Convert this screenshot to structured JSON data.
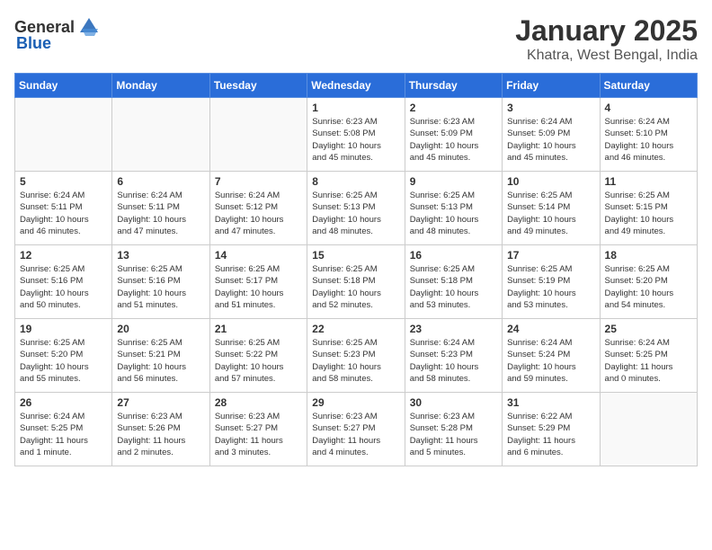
{
  "header": {
    "logo_general": "General",
    "logo_blue": "Blue",
    "title": "January 2025",
    "subtitle": "Khatra, West Bengal, India"
  },
  "days_of_week": [
    "Sunday",
    "Monday",
    "Tuesday",
    "Wednesday",
    "Thursday",
    "Friday",
    "Saturday"
  ],
  "weeks": [
    [
      {
        "day": "",
        "info": ""
      },
      {
        "day": "",
        "info": ""
      },
      {
        "day": "",
        "info": ""
      },
      {
        "day": "1",
        "info": "Sunrise: 6:23 AM\nSunset: 5:08 PM\nDaylight: 10 hours\nand 45 minutes."
      },
      {
        "day": "2",
        "info": "Sunrise: 6:23 AM\nSunset: 5:09 PM\nDaylight: 10 hours\nand 45 minutes."
      },
      {
        "day": "3",
        "info": "Sunrise: 6:24 AM\nSunset: 5:09 PM\nDaylight: 10 hours\nand 45 minutes."
      },
      {
        "day": "4",
        "info": "Sunrise: 6:24 AM\nSunset: 5:10 PM\nDaylight: 10 hours\nand 46 minutes."
      }
    ],
    [
      {
        "day": "5",
        "info": "Sunrise: 6:24 AM\nSunset: 5:11 PM\nDaylight: 10 hours\nand 46 minutes."
      },
      {
        "day": "6",
        "info": "Sunrise: 6:24 AM\nSunset: 5:11 PM\nDaylight: 10 hours\nand 47 minutes."
      },
      {
        "day": "7",
        "info": "Sunrise: 6:24 AM\nSunset: 5:12 PM\nDaylight: 10 hours\nand 47 minutes."
      },
      {
        "day": "8",
        "info": "Sunrise: 6:25 AM\nSunset: 5:13 PM\nDaylight: 10 hours\nand 48 minutes."
      },
      {
        "day": "9",
        "info": "Sunrise: 6:25 AM\nSunset: 5:13 PM\nDaylight: 10 hours\nand 48 minutes."
      },
      {
        "day": "10",
        "info": "Sunrise: 6:25 AM\nSunset: 5:14 PM\nDaylight: 10 hours\nand 49 minutes."
      },
      {
        "day": "11",
        "info": "Sunrise: 6:25 AM\nSunset: 5:15 PM\nDaylight: 10 hours\nand 49 minutes."
      }
    ],
    [
      {
        "day": "12",
        "info": "Sunrise: 6:25 AM\nSunset: 5:16 PM\nDaylight: 10 hours\nand 50 minutes."
      },
      {
        "day": "13",
        "info": "Sunrise: 6:25 AM\nSunset: 5:16 PM\nDaylight: 10 hours\nand 51 minutes."
      },
      {
        "day": "14",
        "info": "Sunrise: 6:25 AM\nSunset: 5:17 PM\nDaylight: 10 hours\nand 51 minutes."
      },
      {
        "day": "15",
        "info": "Sunrise: 6:25 AM\nSunset: 5:18 PM\nDaylight: 10 hours\nand 52 minutes."
      },
      {
        "day": "16",
        "info": "Sunrise: 6:25 AM\nSunset: 5:18 PM\nDaylight: 10 hours\nand 53 minutes."
      },
      {
        "day": "17",
        "info": "Sunrise: 6:25 AM\nSunset: 5:19 PM\nDaylight: 10 hours\nand 53 minutes."
      },
      {
        "day": "18",
        "info": "Sunrise: 6:25 AM\nSunset: 5:20 PM\nDaylight: 10 hours\nand 54 minutes."
      }
    ],
    [
      {
        "day": "19",
        "info": "Sunrise: 6:25 AM\nSunset: 5:20 PM\nDaylight: 10 hours\nand 55 minutes."
      },
      {
        "day": "20",
        "info": "Sunrise: 6:25 AM\nSunset: 5:21 PM\nDaylight: 10 hours\nand 56 minutes."
      },
      {
        "day": "21",
        "info": "Sunrise: 6:25 AM\nSunset: 5:22 PM\nDaylight: 10 hours\nand 57 minutes."
      },
      {
        "day": "22",
        "info": "Sunrise: 6:25 AM\nSunset: 5:23 PM\nDaylight: 10 hours\nand 58 minutes."
      },
      {
        "day": "23",
        "info": "Sunrise: 6:24 AM\nSunset: 5:23 PM\nDaylight: 10 hours\nand 58 minutes."
      },
      {
        "day": "24",
        "info": "Sunrise: 6:24 AM\nSunset: 5:24 PM\nDaylight: 10 hours\nand 59 minutes."
      },
      {
        "day": "25",
        "info": "Sunrise: 6:24 AM\nSunset: 5:25 PM\nDaylight: 11 hours\nand 0 minutes."
      }
    ],
    [
      {
        "day": "26",
        "info": "Sunrise: 6:24 AM\nSunset: 5:25 PM\nDaylight: 11 hours\nand 1 minute."
      },
      {
        "day": "27",
        "info": "Sunrise: 6:23 AM\nSunset: 5:26 PM\nDaylight: 11 hours\nand 2 minutes."
      },
      {
        "day": "28",
        "info": "Sunrise: 6:23 AM\nSunset: 5:27 PM\nDaylight: 11 hours\nand 3 minutes."
      },
      {
        "day": "29",
        "info": "Sunrise: 6:23 AM\nSunset: 5:27 PM\nDaylight: 11 hours\nand 4 minutes."
      },
      {
        "day": "30",
        "info": "Sunrise: 6:23 AM\nSunset: 5:28 PM\nDaylight: 11 hours\nand 5 minutes."
      },
      {
        "day": "31",
        "info": "Sunrise: 6:22 AM\nSunset: 5:29 PM\nDaylight: 11 hours\nand 6 minutes."
      },
      {
        "day": "",
        "info": ""
      }
    ]
  ]
}
